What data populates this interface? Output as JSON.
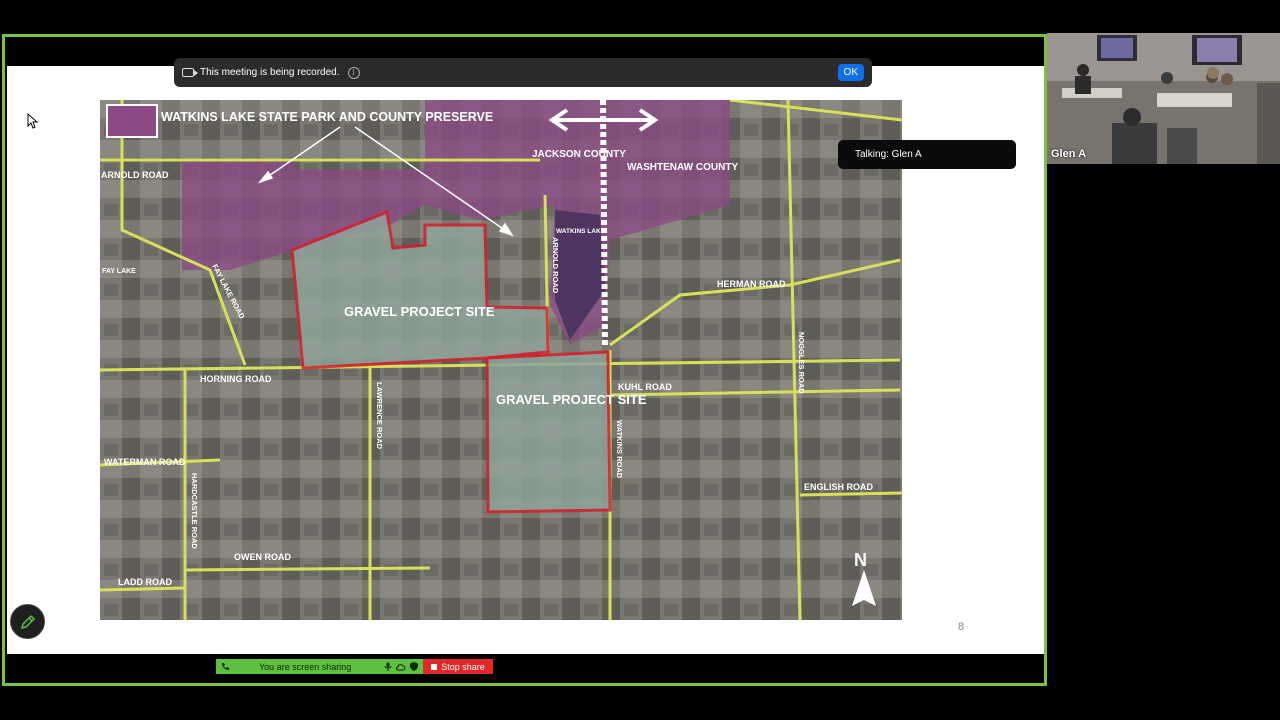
{
  "recording_banner": {
    "message": "This meeting is being recorded.",
    "ok_label": "OK"
  },
  "talking_indicator": {
    "text": "Talking: Glen A"
  },
  "participant": {
    "name": "Glen A"
  },
  "slide": {
    "page_number": "8",
    "map": {
      "legend_title": "WATKINS LAKE STATE PARK AND COUNTY PRESERVE",
      "counties": {
        "west": "JACKSON COUNTY",
        "east": "WASHTENAW COUNTY"
      },
      "lake": "WATKINS LAKE",
      "sites": [
        "GRAVEL PROJECT SITE",
        "GRAVEL PROJECT SITE"
      ],
      "roads": [
        "ARNOLD ROAD",
        "FAY LAKE ROAD",
        "FAY LAKE",
        "ARNOLD ROAD",
        "HERMAN ROAD",
        "NOGGLES ROAD",
        "HORNING ROAD",
        "LAWRENCE ROAD",
        "KUHL ROAD",
        "WATKINS ROAD",
        "WATERMAN ROAD",
        "HARDCASTLE ROAD",
        "ENGLISH ROAD",
        "OWEN ROAD",
        "LADD ROAD"
      ],
      "north_label": "N"
    },
    "colors": {
      "site_outline": "#d4202c",
      "park": "#8b4a85",
      "roads": "#d8e05a",
      "frame": "#7cc242"
    }
  },
  "share_bar": {
    "status_text": "You are screen sharing",
    "stop_label": "Stop share"
  }
}
